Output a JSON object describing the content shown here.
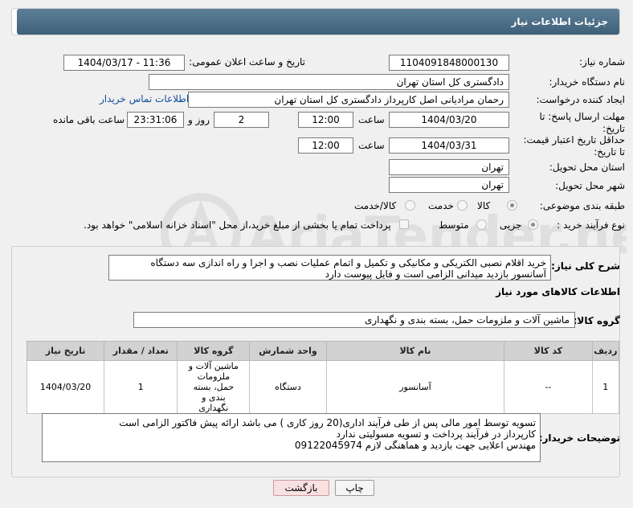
{
  "header": {
    "title": "جزئیات اطلاعات نیاز"
  },
  "form": {
    "need_number_label": "شماره نیاز:",
    "need_number": "1104091848000130",
    "announce_label": "تاریخ و ساعت اعلان عمومی:",
    "announce_value": "1404/03/17 - 11:36",
    "buyer_org_label": "نام دستگاه خریدار:",
    "buyer_org": "دادگستری کل استان تهران",
    "requester_label": "ایجاد کننده درخواست:",
    "requester": "رحمان مرادیانی اصل کارپرداز دادگستری کل استان تهران",
    "contact_link": "اطلاعات تماس خریدار",
    "deadline_label_1": "مهلت ارسال پاسخ: تا",
    "deadline_label_2": "تاریخ:",
    "deadline_date": "1404/03/20",
    "time_label": "ساعت",
    "deadline_time": "12:00",
    "days_value": "2",
    "days_label": "روز و",
    "remaining_time": "23:31:06",
    "remaining_label": "ساعت باقی مانده",
    "price_label_1": "حداقل تاریخ اعتبار قیمت:",
    "price_label_2": "تا تاریخ:",
    "price_date": "1404/03/31",
    "price_time": "12:00",
    "province_label": "استان محل تحویل:",
    "province": "تهران",
    "city_label": "شهر محل تحویل:",
    "city": "تهران",
    "category_label": "طبقه بندی موضوعی:",
    "category_options": [
      "کالا",
      "خدمت",
      "کالا/خدمت"
    ],
    "purchase_label": "نوع فرآیند خرید :",
    "purchase_options": [
      "جزیی",
      "متوسط"
    ],
    "payment_note": "پرداخت تمام یا بخشی از مبلغ خرید،از محل \"اسناد خزانه اسلامی\" خواهد بود."
  },
  "details": {
    "desc_label": "شرح کلی نیاز:",
    "desc_text": "خرید اقلام نصبی الکتریکی و مکانیکی و تکمیل و اتمام عملیات نصب  و اجرا و راه اندازی سه دستگاه آسانسور بازدید میدانی الزامی است و فایل پیوست دارد",
    "items_title": "اطلاعات کالاهای مورد نیاز",
    "group_label": "گروه کالا:",
    "group_value": "ماشین آلات و ملزومات حمل، بسته بندی و نگهداری",
    "table": {
      "headers": [
        "ردیف",
        "کد کالا",
        "نام کالا",
        "واحد شمارش",
        "گروه کالا",
        "تعداد / مقدار",
        "تاریخ نیاز"
      ],
      "rows": [
        [
          "1",
          "--",
          "آسانسور",
          "دستگاه",
          "ماشین آلات و ملزومات حمل، بسته بندی و نگهداری",
          "1",
          "1404/03/20"
        ]
      ]
    },
    "buyer_notes_label": "توضیحات خریدار:",
    "buyer_notes": [
      "تسویه توسط امور مالی پس از طی فرآیند اداری(20 روز کاری )  می باشد ارائه پیش فاکتور الزامی است",
      "کارپرداز در فرآیند پرداخت و تسویه  مسولیتی ندارد",
      "مهندس اعلایی جهت بازدید و هماهنگی لازم 09122045974"
    ]
  },
  "buttons": {
    "print": "چاپ",
    "back": "بازگشت"
  },
  "watermark": {
    "text": "AriaTender.neT"
  }
}
